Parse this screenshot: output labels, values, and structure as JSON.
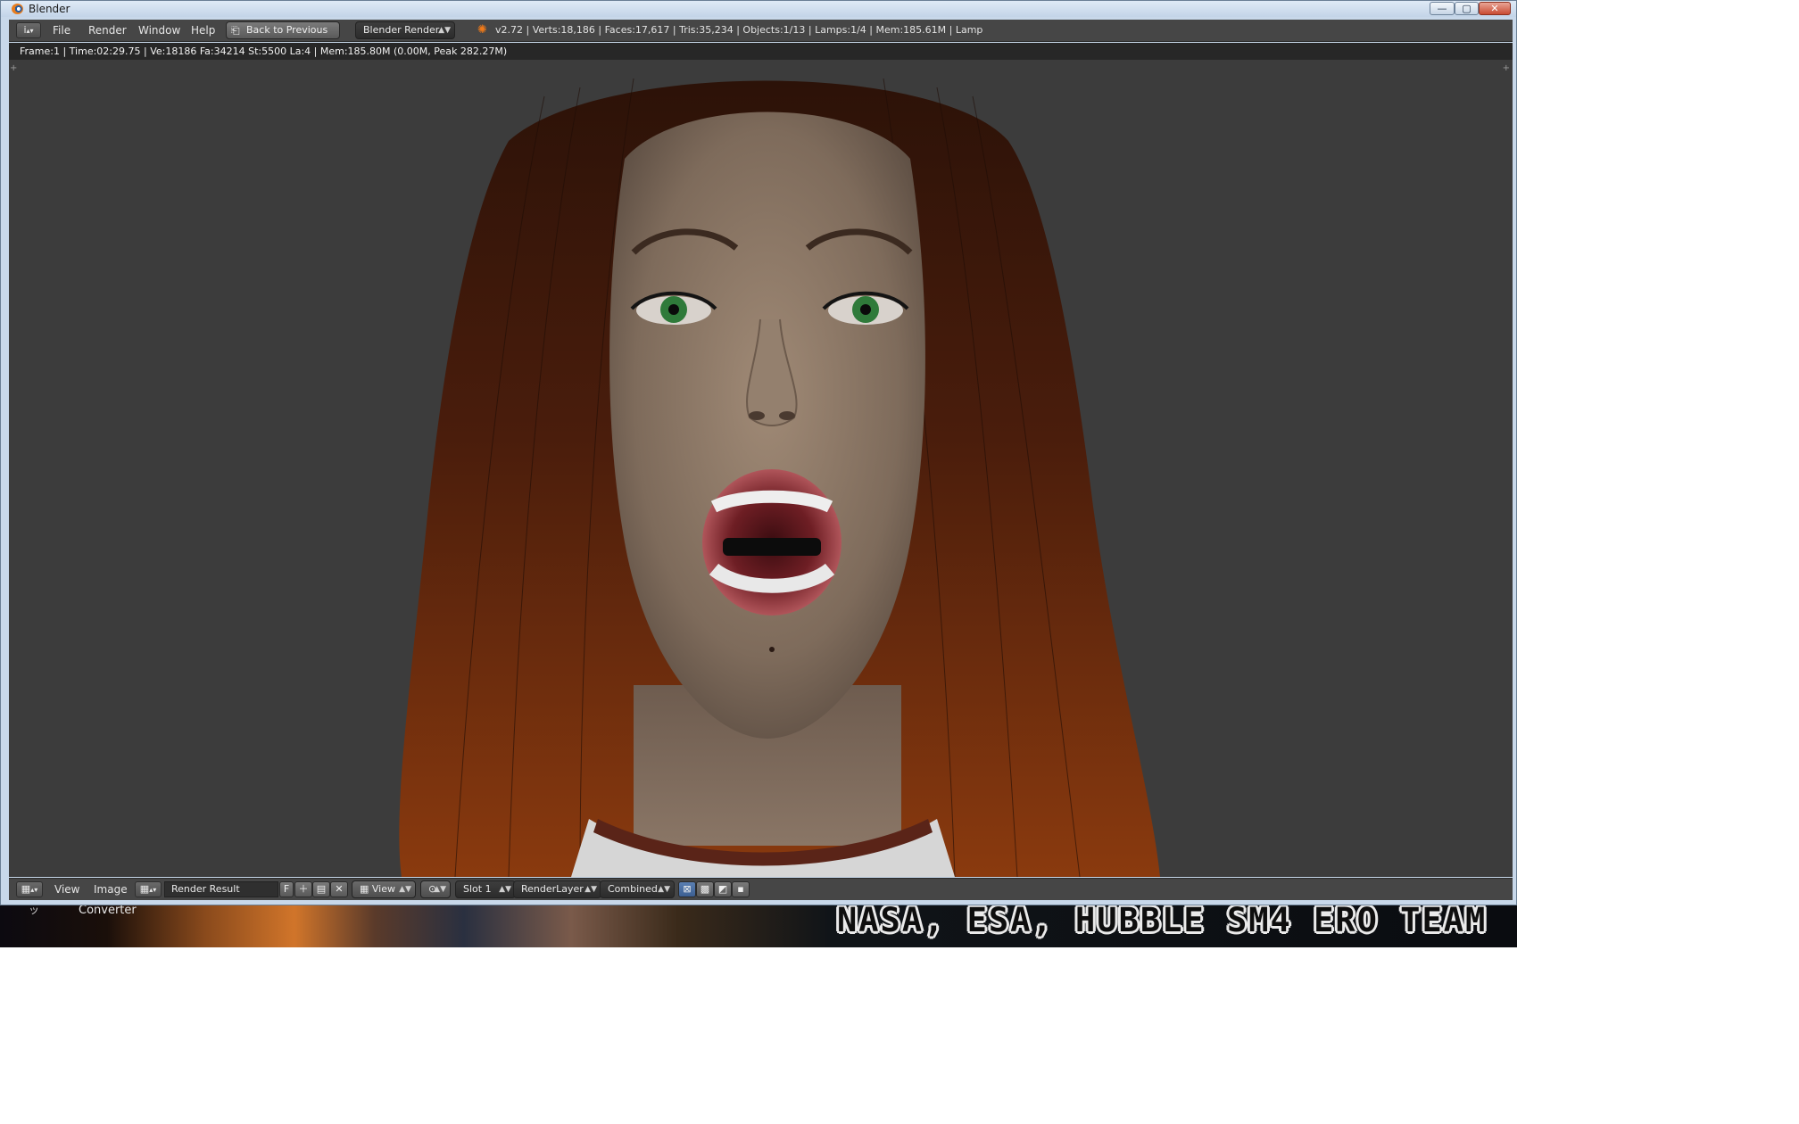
{
  "window": {
    "title": "Blender",
    "controls": {
      "minimize": "—",
      "maximize": "▢",
      "close": "✕"
    }
  },
  "info_header": {
    "editor_icon": "i",
    "menus": [
      "File",
      "Render",
      "Window",
      "Help"
    ],
    "back_button": "Back to Previous",
    "render_engine": "Blender Render",
    "stats": "v2.72 | Verts:18,186 | Faces:17,617 | Tris:35,234 | Objects:1/13 | Lamps:1/4 | Mem:185.61M | Lamp"
  },
  "image_editor": {
    "render_info": "Frame:1 | Time:02:29.75 | Ve:18186 Fa:34214 St:5500 La:4 | Mem:185.80M (0.00M, Peak 282.27M)",
    "corner_glyph": "+"
  },
  "image_header": {
    "menus": [
      "View",
      "Image"
    ],
    "image_name": "Render Result",
    "fake_user": "F",
    "view_select": "View",
    "slot": "Slot 1",
    "render_layer": "RenderLayer",
    "render_pass": "Combined"
  },
  "desktop": {
    "icon_label": "Converter",
    "icon_glyph": "ッ",
    "wallpaper_credit": "NASA, ESA, HUBBLE SM4 ERO TEAM"
  },
  "icons": {
    "window": "blender-logo-icon",
    "engine": "render-engine-icon"
  },
  "colors": {
    "blender_header": "#464646",
    "image_background": "#3c3c3c",
    "window_frame": "#c8d8ea",
    "hair": "#6a2a10",
    "skin": "#8f7a68"
  }
}
